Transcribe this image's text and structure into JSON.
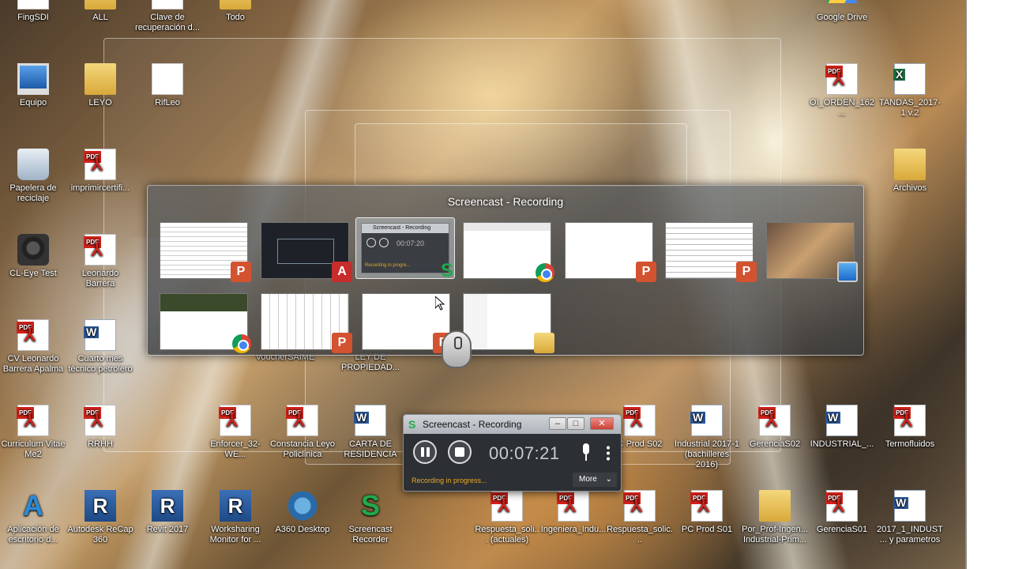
{
  "desktop_icons": [
    {
      "label": "FingSDI",
      "icon": "shortcut-icon"
    },
    {
      "label": "ALL",
      "icon": "folder-icon"
    },
    {
      "label": "Clave de recuperación d...",
      "icon": "file-icon"
    },
    {
      "label": "Todo",
      "icon": "folder-icon"
    },
    {
      "label": "Google Drive",
      "icon": "google-drive-icon"
    },
    {
      "label": "Equipo",
      "icon": "computer-icon"
    },
    {
      "label": "LEYO",
      "icon": "folder-icon"
    },
    {
      "label": "RifLeo",
      "icon": "file-icon"
    },
    {
      "label": "OI_ORDEN_162...",
      "icon": "pdf-icon"
    },
    {
      "label": "TANDAS_2017-1 v.2",
      "icon": "excel-icon"
    },
    {
      "label": "Papelera de reciclaje",
      "icon": "recycle-bin-icon"
    },
    {
      "label": "imprimircertifi...",
      "icon": "pdf-icon"
    },
    {
      "label": "Archivos",
      "icon": "folder-icon"
    },
    {
      "label": "CL-Eye Test",
      "icon": "camera-icon"
    },
    {
      "label": "Leonardo Barrera",
      "icon": "pdf-icon"
    },
    {
      "label": "CV Leonardo Barrera Apalma",
      "icon": "pdf-icon"
    },
    {
      "label": "Cuarto mes técnico petrolero",
      "icon": "word-icon"
    },
    {
      "label": "Curriculum Vitae Me2",
      "icon": "pdf-icon"
    },
    {
      "label": "RRHH",
      "icon": "pdf-icon"
    },
    {
      "label": "Enforcer_32-WE...",
      "icon": "pdf-icon"
    },
    {
      "label": "Constancia Leyo Policlinica",
      "icon": "pdf-icon"
    },
    {
      "label": "CARTA DE RESIDENCIA",
      "icon": "word-icon"
    },
    {
      "label": "C Prod S02",
      "icon": "pdf-icon"
    },
    {
      "label": "Industrial 2017-1 (bachilleres 2016)",
      "icon": "word-icon"
    },
    {
      "label": "GerenciaS02",
      "icon": "pdf-icon"
    },
    {
      "label": "INDUSTRIAL_...",
      "icon": "word-icon"
    },
    {
      "label": "Termofluidos",
      "icon": "pdf-icon"
    },
    {
      "label": "Aplicación de escritorio d...",
      "icon": "azure-icon"
    },
    {
      "label": "Autodesk ReCap 360",
      "icon": "recap-icon"
    },
    {
      "label": "Revit 2017",
      "icon": "revit-icon"
    },
    {
      "label": "Worksharing Monitor for ...",
      "icon": "revit-wm-icon"
    },
    {
      "label": "A360 Desktop",
      "icon": "a360-icon"
    },
    {
      "label": "Screencast Recorder",
      "icon": "screencast-icon"
    },
    {
      "label": "Respuesta_soli... (actuales)",
      "icon": "pdf-icon"
    },
    {
      "label": "Ingeniera_Indu...",
      "icon": "pdf-icon"
    },
    {
      "label": "Respuesta_solic...",
      "icon": "pdf-icon"
    },
    {
      "label": "PC Prod S01",
      "icon": "pdf-icon"
    },
    {
      "label": "Por_Prof-Ingen... Industrial-Prim...",
      "icon": "zip-folder-icon"
    },
    {
      "label": "GerenciaS01",
      "icon": "pdf-icon"
    },
    {
      "label": "2017_1_INDUST... y parametros",
      "icon": "word-icon"
    }
  ],
  "partial_labels": {
    "behind_1": "VoucherSAIME",
    "behind_2": "LEY DE PROPIEDAD..."
  },
  "switcher": {
    "title": "Screencast - Recording",
    "thumbnails": [
      {
        "app": "powerpoint",
        "badge": "ppt-icon"
      },
      {
        "app": "autocad",
        "badge": "autocad-icon"
      },
      {
        "app": "screencast",
        "badge": "screencast-icon",
        "mini_title": "Screencast - Recording",
        "mini_time": "00:07:20",
        "mini_status": "Recording in progre...",
        "selected": true
      },
      {
        "app": "chrome",
        "badge": "chrome-icon"
      },
      {
        "app": "word",
        "badge": "word-icon"
      },
      {
        "app": "powerpoint",
        "badge": "ppt-icon"
      },
      {
        "app": "desktop",
        "badge": "screen-icon"
      },
      {
        "app": "chrome",
        "badge": "chrome-icon"
      },
      {
        "app": "powerpoint",
        "badge": "ppt-icon"
      },
      {
        "app": "powerpoint",
        "badge": "ppt-icon"
      },
      {
        "app": "explorer",
        "badge": "folder-icon"
      }
    ]
  },
  "recorder": {
    "title": "Screencast - Recording",
    "time": "00:07:21",
    "status": "Recording in progress...",
    "more_label": "More",
    "minimize": "–",
    "maximize": "□",
    "close": "✕"
  },
  "colors": {
    "status_text": "#e8a82a",
    "recorder_bg": "#2c2f33",
    "brand_green": "#22a84a"
  }
}
